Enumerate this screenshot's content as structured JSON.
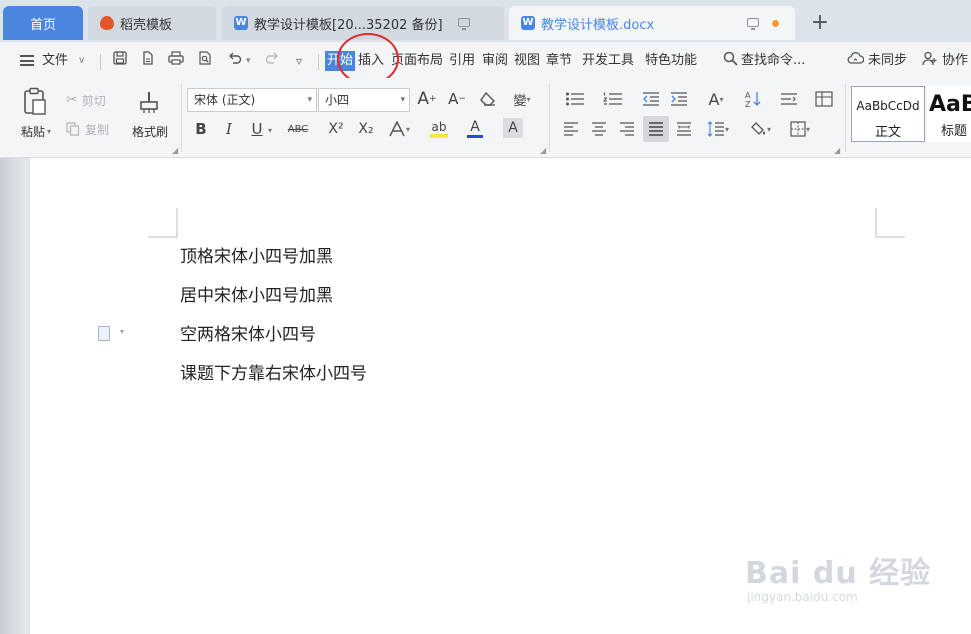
{
  "tabs": {
    "home": "首页",
    "daoke": "稻壳模板",
    "backup": "教学设计模板[20...35202 备份]",
    "current": "教学设计模板.docx",
    "new_tab": "+"
  },
  "menu": {
    "file": "文件",
    "file_arrow": "∨",
    "undo_arrow": "▾",
    "more": "▿",
    "start_a": "开",
    "start_b": "始",
    "insert": "插入",
    "page_layout": "页面布局",
    "references": "引用",
    "review": "审阅",
    "view": "视图",
    "chapter": "章节",
    "developer": "开发工具",
    "special": "特色功能",
    "search": "查找命令...",
    "sync": "未同步",
    "collab": "协作"
  },
  "ribbon": {
    "paste": "粘贴",
    "cut": "剪切",
    "copy": "复制",
    "format_painter": "格式刷",
    "font_name": "宋体 (正文)",
    "font_size": "小四",
    "bold": "B",
    "italic": "I",
    "underline": "U",
    "strikethrough": "ABC",
    "superscript": "X²",
    "subscript": "X₂",
    "style_normal_preview": "AaBbCcDd",
    "style_normal": "正文",
    "style_heading_preview": "AaB",
    "style_heading": "标题"
  },
  "document": {
    "paragraphs": [
      "顶格宋体小四号加黑",
      "居中宋体小四号加黑",
      "空两格宋体小四号",
      "课题下方靠右宋体小四号"
    ]
  },
  "watermark": {
    "brand": "Bai du 经验",
    "url": "jingyan.baidu.com"
  },
  "colors": {
    "accent": "#4a86e0",
    "annotation": "#e02b2b"
  }
}
